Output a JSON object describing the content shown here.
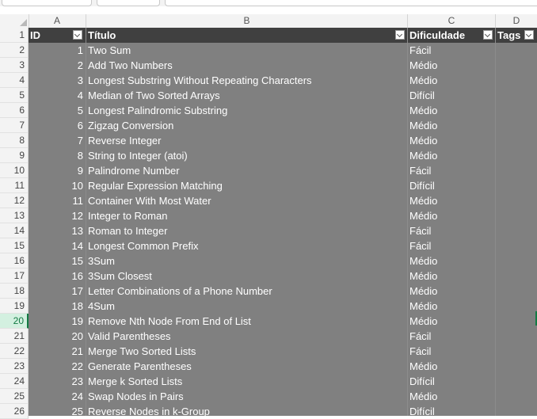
{
  "columns": [
    "A",
    "B",
    "C",
    "D"
  ],
  "header": {
    "row_number": "1",
    "id": "ID",
    "title": "Título",
    "difficulty": "Dificuldade",
    "tags": "Tags"
  },
  "selected_row": "20",
  "rows": [
    {
      "row": "2",
      "id": "1",
      "title": "Two Sum",
      "difficulty": "Fácil"
    },
    {
      "row": "3",
      "id": "2",
      "title": "Add Two Numbers",
      "difficulty": "Médio"
    },
    {
      "row": "4",
      "id": "3",
      "title": "Longest Substring Without Repeating Characters",
      "difficulty": "Médio"
    },
    {
      "row": "5",
      "id": "4",
      "title": "Median of Two Sorted Arrays",
      "difficulty": "Difícil"
    },
    {
      "row": "6",
      "id": "5",
      "title": "Longest Palindromic Substring",
      "difficulty": "Médio"
    },
    {
      "row": "7",
      "id": "6",
      "title": "Zigzag Conversion",
      "difficulty": "Médio"
    },
    {
      "row": "8",
      "id": "7",
      "title": "Reverse Integer",
      "difficulty": "Médio"
    },
    {
      "row": "9",
      "id": "8",
      "title": "String to Integer (atoi)",
      "difficulty": "Médio"
    },
    {
      "row": "10",
      "id": "9",
      "title": "Palindrome Number",
      "difficulty": "Fácil"
    },
    {
      "row": "11",
      "id": "10",
      "title": "Regular Expression Matching",
      "difficulty": "Difícil"
    },
    {
      "row": "12",
      "id": "11",
      "title": "Container With Most Water",
      "difficulty": "Médio"
    },
    {
      "row": "13",
      "id": "12",
      "title": "Integer to Roman",
      "difficulty": "Médio"
    },
    {
      "row": "14",
      "id": "13",
      "title": "Roman to Integer",
      "difficulty": "Fácil"
    },
    {
      "row": "15",
      "id": "14",
      "title": "Longest Common Prefix",
      "difficulty": "Fácil"
    },
    {
      "row": "16",
      "id": "15",
      "title": "3Sum",
      "difficulty": "Médio"
    },
    {
      "row": "17",
      "id": "16",
      "title": "3Sum Closest",
      "difficulty": "Médio"
    },
    {
      "row": "18",
      "id": "17",
      "title": "Letter Combinations of a Phone Number",
      "difficulty": "Médio"
    },
    {
      "row": "19",
      "id": "18",
      "title": "4Sum",
      "difficulty": "Médio"
    },
    {
      "row": "20",
      "id": "19",
      "title": "Remove Nth Node From End of List",
      "difficulty": "Médio"
    },
    {
      "row": "21",
      "id": "20",
      "title": "Valid Parentheses",
      "difficulty": "Fácil"
    },
    {
      "row": "22",
      "id": "21",
      "title": "Merge Two Sorted Lists",
      "difficulty": "Fácil"
    },
    {
      "row": "23",
      "id": "22",
      "title": "Generate Parentheses",
      "difficulty": "Médio"
    },
    {
      "row": "24",
      "id": "23",
      "title": "Merge k Sorted Lists",
      "difficulty": "Difícil"
    },
    {
      "row": "25",
      "id": "24",
      "title": "Swap Nodes in Pairs",
      "difficulty": "Médio"
    },
    {
      "row": "26",
      "id": "25",
      "title": "Reverse Nodes in k-Group",
      "difficulty": "Difícil"
    }
  ]
}
